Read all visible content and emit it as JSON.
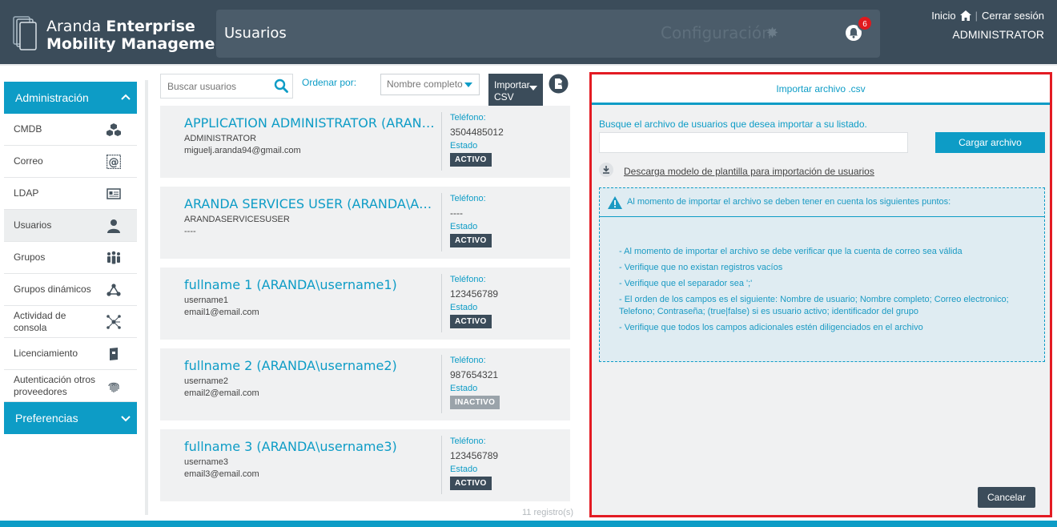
{
  "header": {
    "brand_light": "Aranda ",
    "brand_bold": "Enterprise",
    "brand_line2": "Mobility Management",
    "module_title": "Usuarios",
    "config_label": "Configuración",
    "notification_count": "6",
    "home_label": "Inicio",
    "sep": "|",
    "logout_label": "Cerrar sesión",
    "user_role": "ADMINISTRATOR"
  },
  "sidebar": {
    "admin_section": "Administración",
    "prefs_section": "Preferencias",
    "items": [
      {
        "label": "CMDB",
        "icon": "cubes-icon"
      },
      {
        "label": "Correo",
        "icon": "at-sign-icon"
      },
      {
        "label": "LDAP",
        "icon": "directory-card-icon"
      },
      {
        "label": "Usuarios",
        "icon": "user-icon"
      },
      {
        "label": "Grupos",
        "icon": "group-icon"
      },
      {
        "label": "Grupos dinámicos",
        "icon": "share-nodes-icon"
      },
      {
        "label": "Actividad de consola",
        "icon": "network-icon"
      },
      {
        "label": "Licenciamiento",
        "icon": "license-book-icon"
      },
      {
        "label": "Autenticación otros proveedores",
        "icon": "fingerprint-icon"
      }
    ]
  },
  "toolbar": {
    "search_placeholder": "Buscar usuarios",
    "sort_label": "Ordenar por:",
    "sort_value": "Nombre completo",
    "import_line1": "Importar",
    "import_line2": "CSV"
  },
  "users": [
    {
      "name": "APPLICATION ADMINISTRATOR (ARANDA\\ADMINISTRATOR)",
      "username": "ADMINISTRATOR",
      "email": "miguelj.aranda94@gmail.com",
      "phone_label": "Teléfono:",
      "phone": "3504485012",
      "status_label": "Estado",
      "status": "ACTIVO"
    },
    {
      "name": "ARANDA SERVICES USER (ARANDA\\ARANDASERVICESUSER)",
      "username": "ARANDASERVICESUSER",
      "email": "----",
      "phone_label": "Teléfono:",
      "phone": "----",
      "status_label": "Estado",
      "status": "ACTIVO"
    },
    {
      "name": "fullname 1 (ARANDA\\username1)",
      "username": "username1",
      "email": "email1@email.com",
      "phone_label": "Teléfono:",
      "phone": "123456789",
      "status_label": "Estado",
      "status": "ACTIVO"
    },
    {
      "name": "fullname 2 (ARANDA\\username2)",
      "username": "username2",
      "email": "email2@email.com",
      "phone_label": "Teléfono:",
      "phone": "987654321",
      "status_label": "Estado",
      "status": "INACTIVO"
    },
    {
      "name": "fullname 3 (ARANDA\\username3)",
      "username": "username3",
      "email": "email3@email.com",
      "phone_label": "Teléfono:",
      "phone": "123456789",
      "status_label": "Estado",
      "status": "ACTIVO"
    }
  ],
  "record_count": "11 registro(s)",
  "import_panel": {
    "title": "Importar archivo .csv",
    "instruction": "Busque el archivo de usuarios que desea importar a su listado.",
    "upload_button": "Cargar archivo",
    "download_link": "Descarga modelo de plantilla para importación de usuarios",
    "notice_title": "Al momento de importar el archivo se deben tener en cuenta los siguientes puntos:",
    "notice_items": [
      "- Al momento de importar el archivo se debe verificar que la cuenta de correo sea válida",
      "- Verifique que no existan registros vacíos",
      "- Verifique que el separador sea ';'",
      "- El orden de los campos es el siguiente: Nombre de usuario; Nombre completo; Correo electronico; Telefono; Contraseña; (true|false) si es usuario activo; identificador del grupo",
      "- Verifique que todos los campos adicionales estén diligenciados en el archivo"
    ],
    "cancel_button": "Cancelar"
  },
  "colors": {
    "accent": "#0d9cc6",
    "header_bg": "#3b4c5a",
    "highlight_border": "#e31b23"
  }
}
